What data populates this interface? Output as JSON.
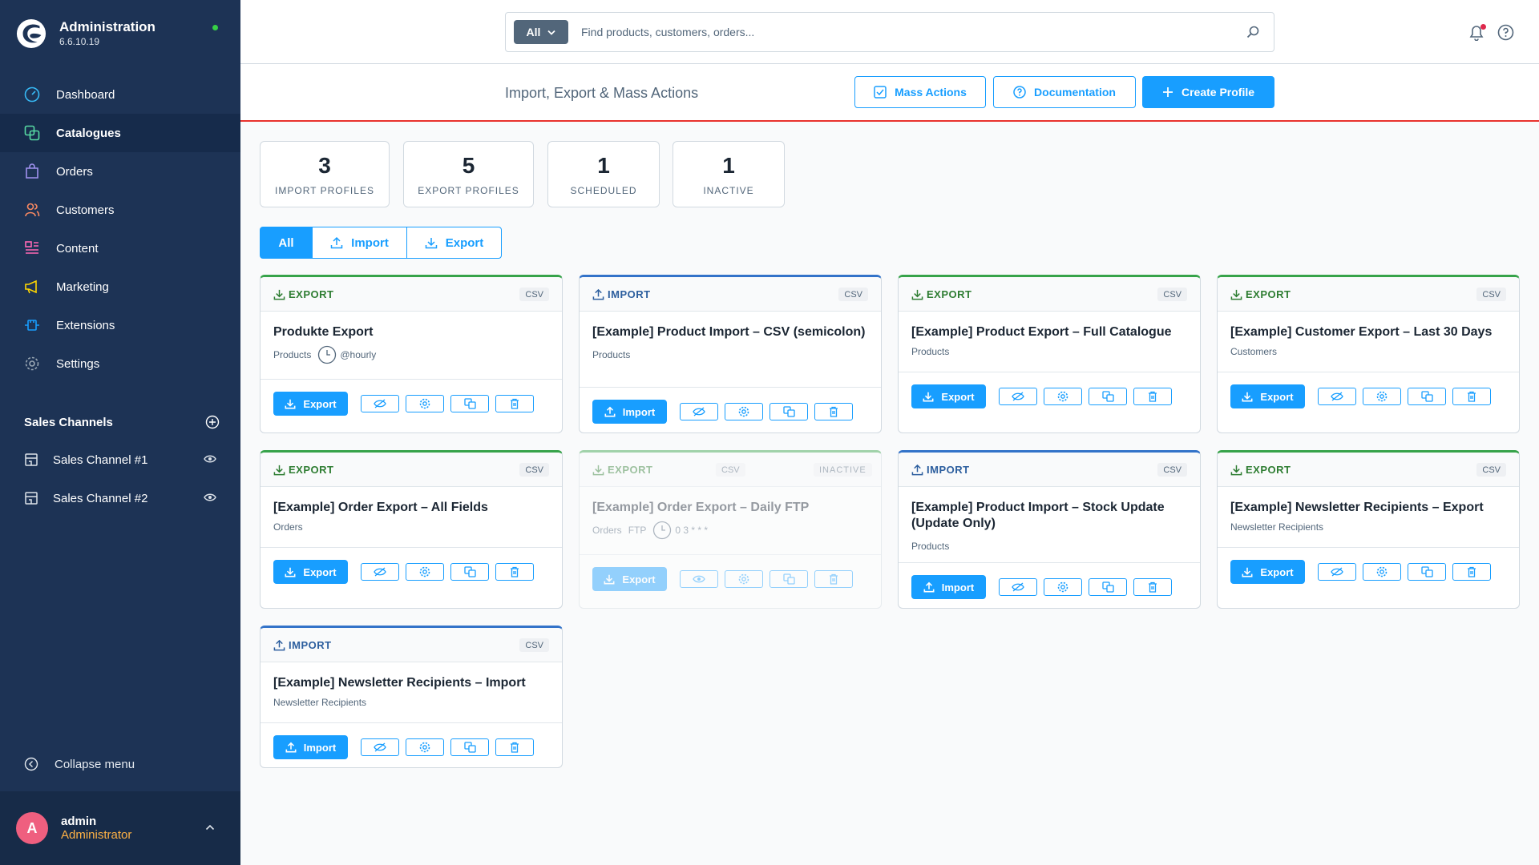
{
  "app": {
    "title": "Administration",
    "version": "6.6.10.19"
  },
  "nav": [
    {
      "label": "Dashboard",
      "icon": "dashboard-icon",
      "color": "#37b9f5"
    },
    {
      "label": "Catalogues",
      "icon": "catalogues-icon",
      "color": "#57d9a3"
    },
    {
      "label": "Orders",
      "icon": "orders-icon",
      "color": "#a092f0"
    },
    {
      "label": "Customers",
      "icon": "customers-icon",
      "color": "#f88962"
    },
    {
      "label": "Content",
      "icon": "content-icon",
      "color": "#ff68b4"
    },
    {
      "label": "Marketing",
      "icon": "marketing-icon",
      "color": "#ffd700"
    },
    {
      "label": "Extensions",
      "icon": "extensions-icon",
      "color": "#189eff"
    },
    {
      "label": "Settings",
      "icon": "settings-icon",
      "color": "#9aa8b5"
    }
  ],
  "active_nav": "Catalogues",
  "sales_channels": {
    "heading": "Sales Channels",
    "items": [
      {
        "label": "Sales Channel #1"
      },
      {
        "label": "Sales Channel #2"
      }
    ]
  },
  "collapse_label": "Collapse menu",
  "user": {
    "initial": "A",
    "name": "admin",
    "role": "Administrator"
  },
  "search": {
    "type": "All",
    "placeholder": "Find products, customers, orders..."
  },
  "page": {
    "title": "Import, Export & Mass Actions",
    "mass_actions": "Mass Actions",
    "documentation": "Documentation",
    "create_profile": "Create Profile"
  },
  "stats": [
    {
      "value": "3",
      "label": "IMPORT PROFILES"
    },
    {
      "value": "5",
      "label": "EXPORT PROFILES"
    },
    {
      "value": "1",
      "label": "SCHEDULED"
    },
    {
      "value": "1",
      "label": "INACTIVE"
    }
  ],
  "filters": [
    "All",
    "Import",
    "Export"
  ],
  "active_filter": "All",
  "inactive_label": "INACTIVE",
  "profiles": [
    {
      "type": "EXPORT",
      "format": "CSV",
      "title": "Produkte Export",
      "entity": "Products",
      "schedule": "@hourly",
      "action": "Export"
    },
    {
      "type": "IMPORT",
      "format": "CSV",
      "title": "[Example] Product Import – CSV (semicolon)",
      "entity": "Products",
      "action": "Import"
    },
    {
      "type": "EXPORT",
      "format": "CSV",
      "title": "[Example] Product Export – Full Catalogue",
      "entity": "Products",
      "action": "Export"
    },
    {
      "type": "EXPORT",
      "format": "CSV",
      "title": "[Example] Customer Export – Last 30 Days",
      "entity": "Customers",
      "action": "Export"
    },
    {
      "type": "EXPORT",
      "format": "CSV",
      "title": "[Example] Order Export – All Fields",
      "entity": "Orders",
      "action": "Export"
    },
    {
      "type": "EXPORT",
      "format": "CSV",
      "title": "[Example] Order Export – Daily FTP",
      "entity": "Orders",
      "transport": "FTP",
      "schedule": "0 3 * * *",
      "action": "Export",
      "inactive": true
    },
    {
      "type": "IMPORT",
      "format": "CSV",
      "title": "[Example] Product Import – Stock Update (Update Only)",
      "entity": "Products",
      "action": "Import"
    },
    {
      "type": "EXPORT",
      "format": "CSV",
      "title": "[Example] Newsletter Recipients – Export",
      "entity": "Newsletter Recipients",
      "action": "Export"
    },
    {
      "type": "IMPORT",
      "format": "CSV",
      "title": "[Example] Newsletter Recipients – Import",
      "entity": "Newsletter Recipients",
      "action": "Import"
    }
  ],
  "colors": {
    "sidebar": "#1d3355",
    "primary": "#189eff",
    "export": "#37a34a",
    "import": "#3373c9",
    "accent_line": "#e9322d"
  }
}
